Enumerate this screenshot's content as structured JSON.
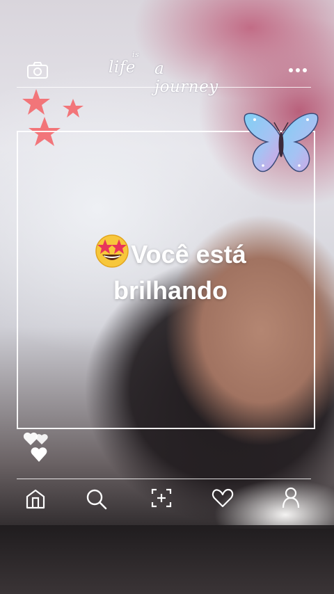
{
  "header": {
    "camera_icon": "camera-icon",
    "title_life": "life",
    "title_is": "is",
    "title_journey": "a journey",
    "more_icon": "more-icon"
  },
  "caption": {
    "emoji": "star-struck-emoji",
    "line1": "Você está",
    "line2": "brilhando"
  },
  "stickers": [
    "pink-stars",
    "butterfly",
    "hearts"
  ],
  "nav": {
    "items": [
      "home-icon",
      "search-icon",
      "add-post-icon",
      "heart-icon",
      "profile-icon"
    ]
  },
  "colors": {
    "frame": "#ffffff",
    "stars": "#f26f73",
    "butterfly_blue": "#8fc9f2",
    "butterfly_pink": "#d9a0e0"
  }
}
